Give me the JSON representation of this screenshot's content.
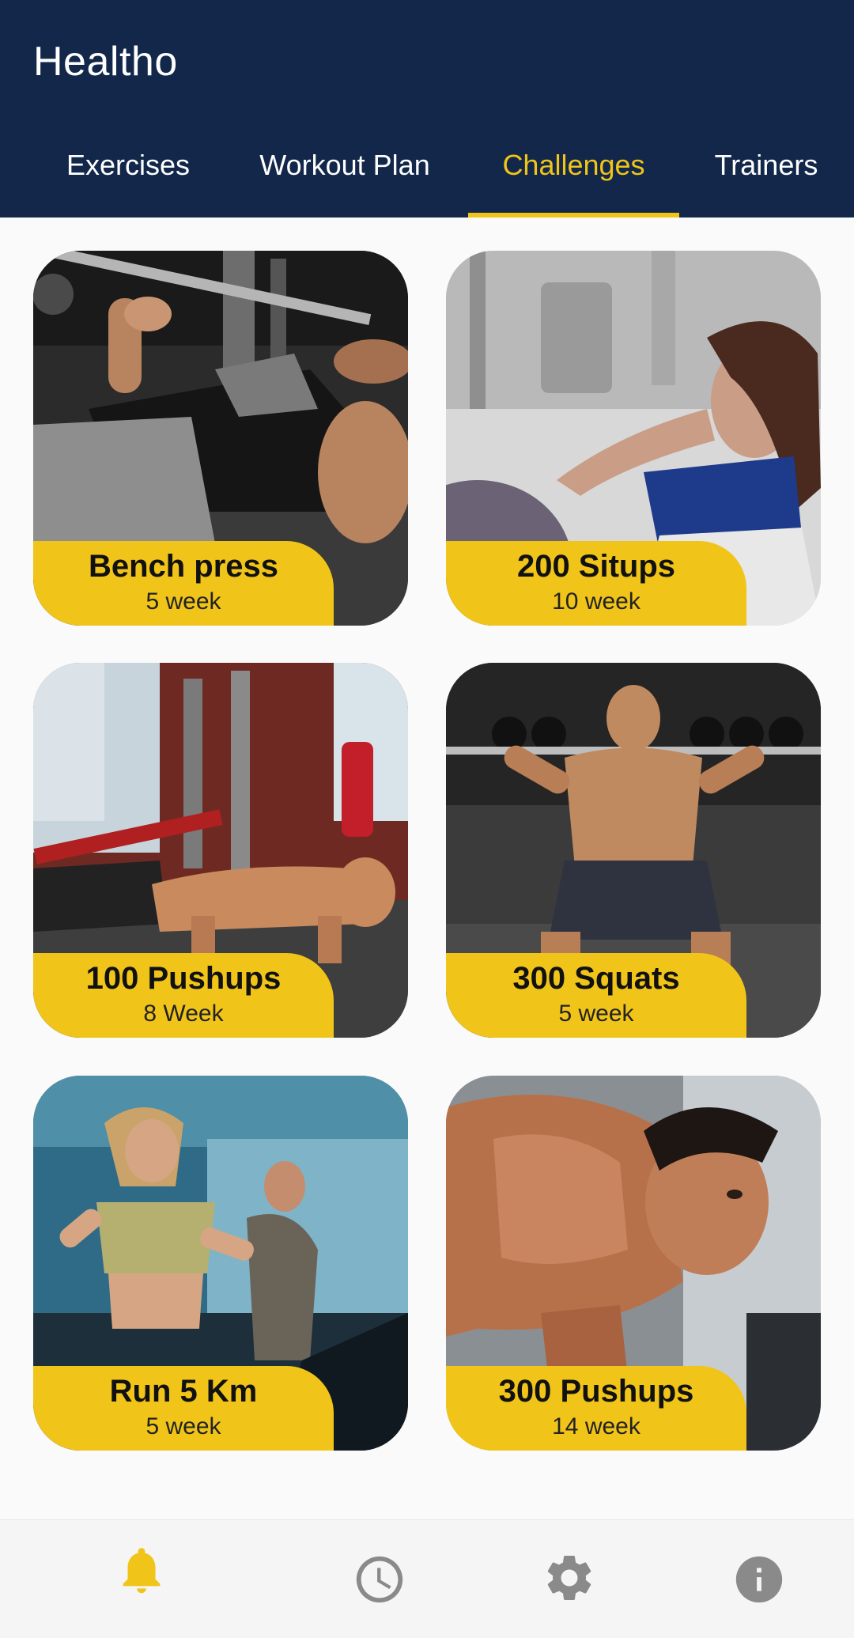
{
  "app": {
    "title": "Healtho"
  },
  "tabs": [
    {
      "label": "Exercises",
      "active": false
    },
    {
      "label": "Workout Plan",
      "active": false
    },
    {
      "label": "Challenges",
      "active": true
    },
    {
      "label": "Trainers",
      "active": false
    }
  ],
  "challenges": [
    {
      "title": "Bench press",
      "duration": "5 week"
    },
    {
      "title": "200 Situps",
      "duration": "10 week"
    },
    {
      "title": "100 Pushups",
      "duration": "8 Week"
    },
    {
      "title": "300 Squats",
      "duration": "5 week"
    },
    {
      "title": "Run 5 Km",
      "duration": "5 week"
    },
    {
      "title": "300 Pushups",
      "duration": "14 week"
    }
  ],
  "bottom_nav": [
    {
      "icon": "bell-icon",
      "active": true
    },
    {
      "icon": "clock-icon",
      "active": false
    },
    {
      "icon": "gear-icon",
      "active": false
    },
    {
      "icon": "info-icon",
      "active": false
    }
  ],
  "colors": {
    "header": "#12274a",
    "accent": "#f0c419",
    "background": "#fafafa",
    "nav_inactive": "#8a8a8a"
  }
}
